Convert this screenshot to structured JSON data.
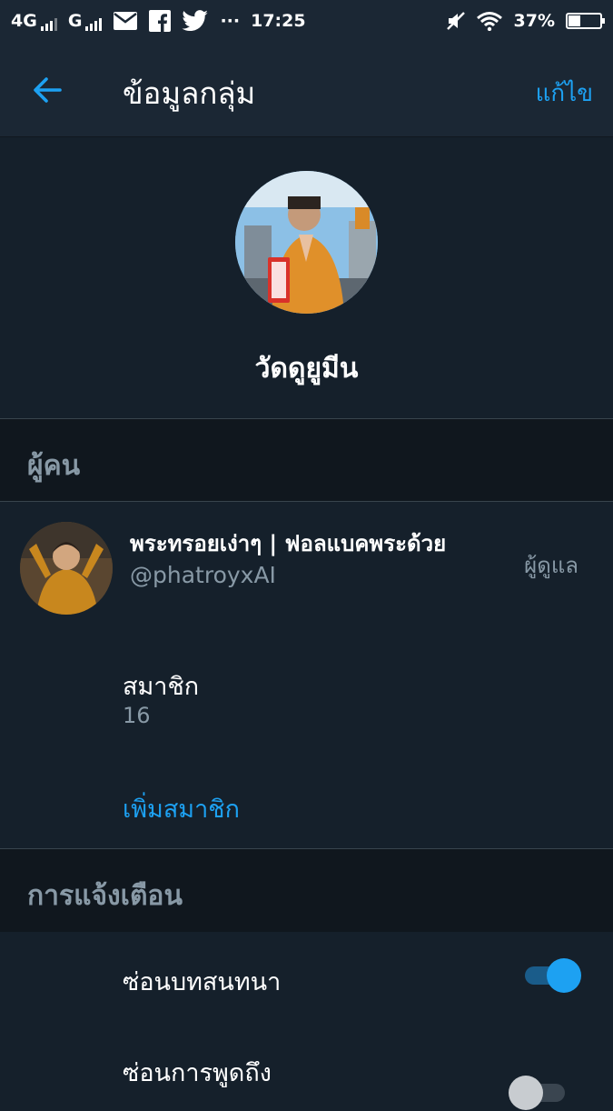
{
  "status_bar": {
    "network1": "4G",
    "network2": "G",
    "overflow": "···",
    "time": "17:25",
    "battery": "37%",
    "battery_level": 0.37
  },
  "app_bar": {
    "title": "ข้อมูลกลุ่ม",
    "edit_label": "แก้ไข"
  },
  "group": {
    "name": "วัดดูยูมีน"
  },
  "people_section": {
    "header": "ผู้คน",
    "members": [
      {
        "name": "พระทรอยเง่าๆ | ฟอลแบคพระด้วย",
        "handle": "@phatroyxAI",
        "role": "ผู้ดูแล"
      }
    ],
    "count_label": "สมาชิก",
    "count_value": "16",
    "add_member_label": "เพิ่มสมาชิก"
  },
  "notifications_section": {
    "header": "การแจ้งเตือน",
    "settings": [
      {
        "label": "ซ่อนบทสนทนา",
        "enabled": true
      },
      {
        "label": "ซ่อนการพูดถึง",
        "enabled": false
      }
    ]
  },
  "colors": {
    "accent": "#1da1f2",
    "background": "#15202b",
    "header_bg": "#10171e",
    "secondary_text": "#8899a6"
  }
}
